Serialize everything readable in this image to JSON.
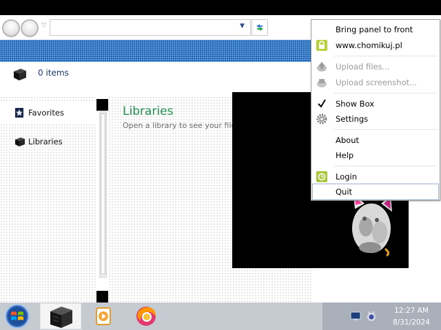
{
  "explorer": {
    "status": {
      "items_count": "0 items"
    },
    "navigation": {
      "favorites": "Favorites",
      "libraries": "Libraries"
    },
    "content": {
      "title": "Libraries",
      "subtitle": "Open a library to see your files"
    }
  },
  "context_menu": {
    "items": [
      {
        "label": "Bring panel to front",
        "enabled": true,
        "icon": ""
      },
      {
        "label": "www.chomikuj.pl",
        "enabled": true,
        "icon": "chomikuj-lock-icon"
      },
      {
        "label": "Upload files...",
        "enabled": false,
        "icon": "upload-files-icon"
      },
      {
        "label": "Upload screenshot...",
        "enabled": false,
        "icon": "upload-screenshot-icon"
      },
      {
        "label": "Show Box",
        "enabled": true,
        "checked": true,
        "icon": "checkmark-icon"
      },
      {
        "label": "Settings",
        "enabled": true,
        "icon": "gear-icon"
      },
      {
        "label": "About",
        "enabled": true,
        "icon": ""
      },
      {
        "label": "Help",
        "enabled": true,
        "icon": ""
      },
      {
        "label": "Login",
        "enabled": true,
        "icon": "login-icon"
      },
      {
        "label": "Quit",
        "enabled": true,
        "icon": "",
        "highlighted": true
      }
    ]
  },
  "taskbar": {
    "clock_time": "12:27 AM",
    "clock_date": "8/31/2024",
    "pinned": [
      "start-orb-icon",
      "explorer-icon",
      "media-player-icon",
      "firefox-icon"
    ]
  },
  "colors": {
    "library_title": "#1e8f4e",
    "accent_band": "#1e64b4",
    "taskbar": "#c6cbd2"
  }
}
